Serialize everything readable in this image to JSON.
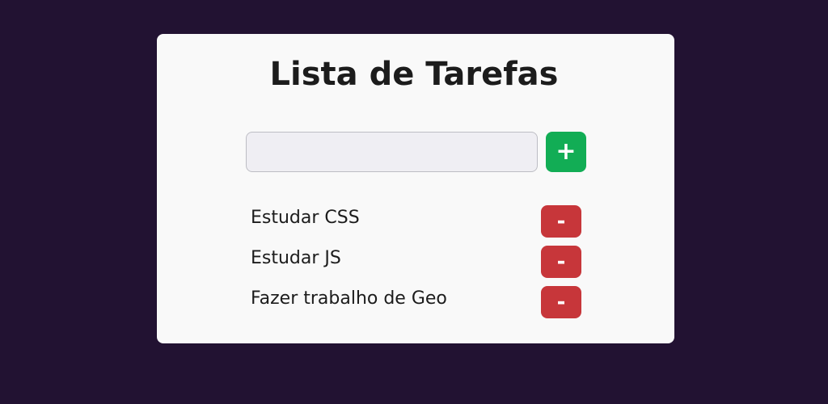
{
  "app": {
    "title": "Lista de Tarefas"
  },
  "input": {
    "value": "",
    "placeholder": ""
  },
  "add_button": {
    "label": "+"
  },
  "tasks": [
    {
      "label": "Estudar CSS",
      "remove_label": "-"
    },
    {
      "label": "Estudar JS",
      "remove_label": "-"
    },
    {
      "label": "Fazer trabalho de Geo",
      "remove_label": "-"
    }
  ],
  "colors": {
    "background": "#221232",
    "card": "#f9f9f9",
    "add_button": "#12ad55",
    "remove_button": "#c7363a",
    "text": "#1c1c1c",
    "input_background": "#efeef3"
  },
  "icons": {
    "add": "plus-icon",
    "remove": "minus-icon"
  }
}
